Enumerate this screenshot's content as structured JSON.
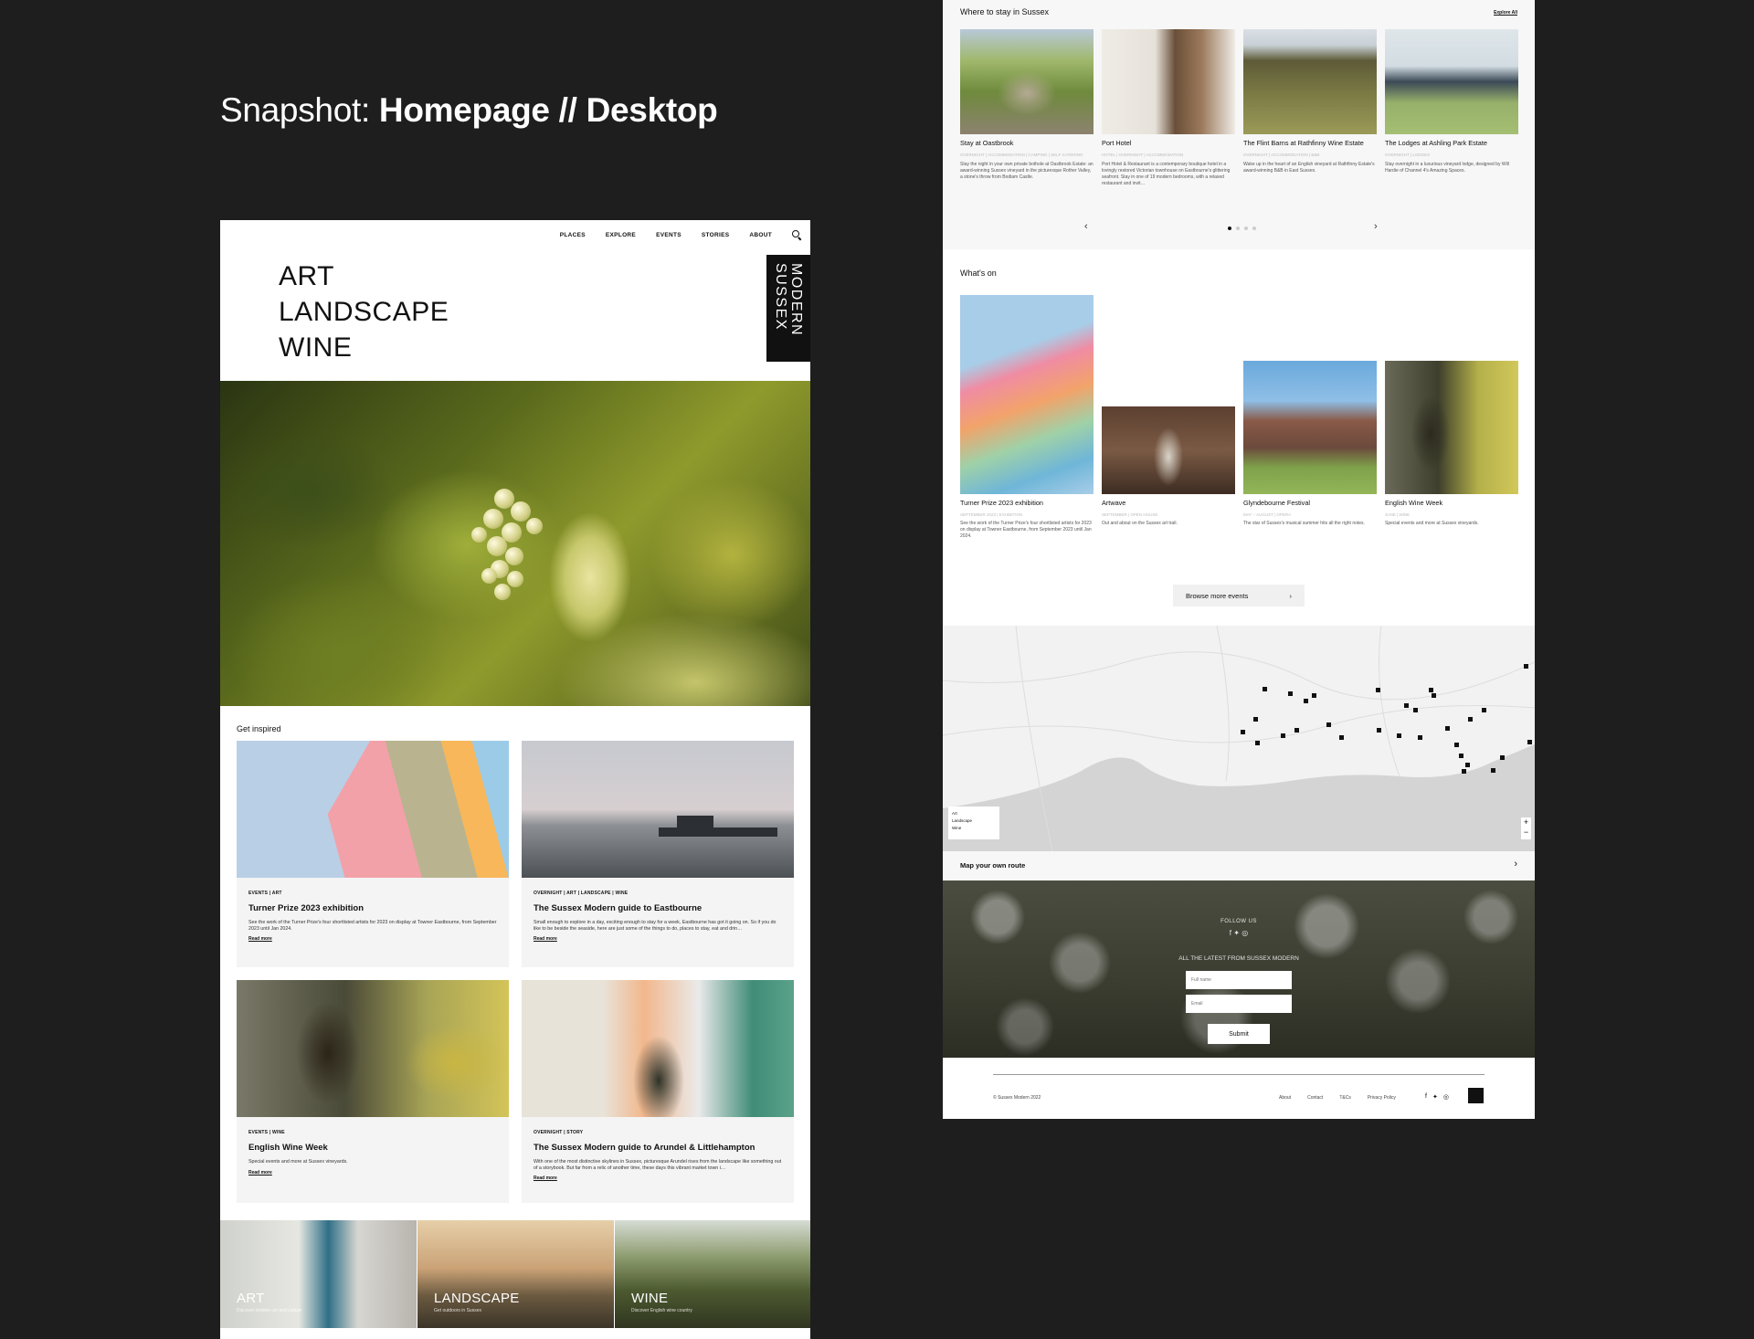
{
  "snapshot": {
    "prefix": "Snapshot: ",
    "bold": "Homepage // Desktop"
  },
  "nav": {
    "items": [
      "PLACES",
      "EXPLORE",
      "EVENTS",
      "STORIES",
      "ABOUT"
    ]
  },
  "hero": {
    "words": [
      "ART",
      "LANDSCAPE",
      "WINE"
    ],
    "logo_lines": [
      "MODERN",
      "SUSSEX"
    ]
  },
  "inspired": {
    "label": "Get inspired",
    "cards": [
      {
        "tags": "EVENTS  |  ART",
        "title": "Turner Prize 2023 exhibition",
        "desc": "See the work of the Turner Prize's four shortlisted artists for 2023 on display at Towner Eastbourne, from September 2023 until Jan 2024.",
        "more": "Read more"
      },
      {
        "tags": "OVERNIGHT  |  ART  |  LANDSCAPE  |  WINE",
        "title": "The Sussex Modern guide to Eastbourne",
        "desc": "Small enough to explore in a day, exciting enough to stay for a week, Eastbourne has got it going on. So if you do like to be beside the seaside, here are just some of the things to do, places to stay, eat and drin…",
        "more": "Read more"
      },
      {
        "tags": "EVENTS  |  WINE",
        "title": "English Wine Week",
        "desc": "Special events and more at Sussex vineyards.",
        "more": "Read more"
      },
      {
        "tags": "OVERNIGHT  |  STORY",
        "title": "The Sussex Modern guide to Arundel & Littlehampton",
        "desc": "With one of the most distinctive skylines in Sussex, picturesque Arundel rises from the landscape like something out of a storybook. But far from a relic of another time, these days this vibrant market town i…",
        "more": "Read more"
      }
    ]
  },
  "categories": [
    {
      "label": "ART",
      "sub": "Discover modern art and culture"
    },
    {
      "label": "LANDSCAPE",
      "sub": "Get outdoors in Sussex"
    },
    {
      "label": "WINE",
      "sub": "Discover English wine country"
    }
  ],
  "stay": {
    "label": "Where to stay in Sussex",
    "explore": "Explore All",
    "cards": [
      {
        "title": "Stay at Oastbrook",
        "meta": "OVERNIGHT  |  ACCOMMODATION  |  CAMPING  |  SELF CATERING",
        "desc": "Stay the night in your own private bothole at Oastbrook Estate: an award-winning Sussex vineyard in the picturesque Rother Valley, a stone's throw from Bodiam Castle."
      },
      {
        "title": "Port Hotel",
        "meta": "HOTEL  |  OVERNIGHT  |  ACCOMMODATION",
        "desc": "Port Hotel & Restaurant is a contemporary boutique hotel in a lovingly restored Victorian townhouse on Eastbourne's glittering seafront. Stay in one of 19 modern bedrooms, with a relaxed restaurant and invit…"
      },
      {
        "title": "The Flint Barns at Rathfinny Wine Estate",
        "meta": "OVERNIGHT  |  ACCOMMODATION  |  B&B",
        "desc": "Wake up in the heart of an English vineyard at Rathfinny Estate's award-winning B&B in East Sussex."
      },
      {
        "title": "The Lodges at Ashling Park Estate",
        "meta": "OVERNIGHT  |  LODGES",
        "desc": "Stay overnight in a luxurious vineyard lodge, designed by Will Hardie of Channel 4's Amazing Spaces."
      }
    ]
  },
  "whats_on": {
    "label": "What's on",
    "cards": [
      {
        "title": "Turner Prize 2023 exhibition",
        "meta": "SEPTEMBER 2023  |  EXHIBITION",
        "desc": "See the work of the Turner Prize's four shortlisted artists for 2023 on display at Towner Eastbourne, from September 2023 until Jan 2024."
      },
      {
        "title": "Artwave",
        "meta": "SEPTEMBER  |  OPEN HOUSE",
        "desc": "Out and about on the Sussex art trail."
      },
      {
        "title": "Glyndebourne Festival",
        "meta": "MAY – AUGUST  |  OPERA",
        "desc": "The star of Sussex's musical summer hits all the right notes."
      },
      {
        "title": "English Wine Week",
        "meta": "JUNE  |  WINE",
        "desc": "Special events and more at Sussex vineyards."
      }
    ],
    "browse": "Browse more events"
  },
  "map": {
    "legend": [
      "Art",
      "Landscape",
      "Wine"
    ],
    "route_label": "Map your own route"
  },
  "follow": {
    "follow_label": "FOLLOW US",
    "latest_label": "ALL THE LATEST FROM SUSSEX MODERN",
    "name_placeholder": "Full name",
    "email_placeholder": "Email",
    "submit": "Submit"
  },
  "footer": {
    "copy": "© Sussex Modern 2022",
    "links": [
      "About",
      "Contact",
      "T&Cs",
      "Privacy Policy"
    ]
  }
}
